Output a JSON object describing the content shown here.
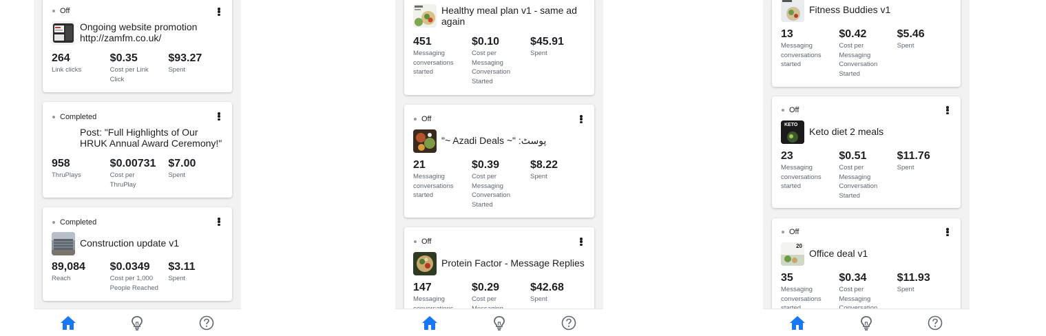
{
  "phones": [
    {
      "cards": [
        {
          "status": "Off",
          "title": "Ongoing website promotion http://zamfm.co.uk/",
          "thumb_icon": "website-thumbnail-icon",
          "metrics": [
            {
              "value": "264",
              "label": "Link clicks"
            },
            {
              "value": "$0.35",
              "label": "Cost per Link Click"
            },
            {
              "value": "$93.27",
              "label": "Spent"
            }
          ]
        },
        {
          "status": "Completed",
          "title": "Post: \"Full Highlights of Our HRUK Annual Award Ceremony!\"",
          "thumb_icon": "",
          "metrics": [
            {
              "value": "958",
              "label": "ThruPlays"
            },
            {
              "value": "$0.00731",
              "label": "Cost per ThruPlay"
            },
            {
              "value": "$7.00",
              "label": "Spent"
            }
          ]
        },
        {
          "status": "Completed",
          "title": "Construction update v1",
          "thumb_icon": "construction-thumbnail-icon",
          "metrics": [
            {
              "value": "89,084",
              "label": "Reach"
            },
            {
              "value": "$0.0349",
              "label": "Cost per 1,000 People Reached"
            },
            {
              "value": "$3.11",
              "label": "Spent"
            }
          ]
        }
      ]
    },
    {
      "cards": [
        {
          "status": "",
          "title": "Healthy meal plan v1 - same ad again",
          "thumb_icon": "meal-plan-thumbnail-icon",
          "metrics": [
            {
              "value": "451",
              "label": "Messaging conversations started"
            },
            {
              "value": "$0.10",
              "label": "Cost per Messaging Conversation Started"
            },
            {
              "value": "$45.91",
              "label": "Spent"
            }
          ]
        },
        {
          "status": "Off",
          "title": "\"~ Azadi Deals ~\" :پوسٹ",
          "thumb_icon": "azadi-deals-thumbnail-icon",
          "metrics": [
            {
              "value": "21",
              "label": "Messaging conversations started"
            },
            {
              "value": "$0.39",
              "label": "Cost per Messaging Conversation Started"
            },
            {
              "value": "$8.22",
              "label": "Spent"
            }
          ]
        },
        {
          "status": "Off",
          "title": "Protein Factor - Message Replies",
          "thumb_icon": "protein-factor-thumbnail-icon",
          "metrics": [
            {
              "value": "147",
              "label": "Messaging conversations started"
            },
            {
              "value": "$0.29",
              "label": "Cost per Messaging Conversation Started"
            },
            {
              "value": "$42.68",
              "label": "Spent"
            }
          ]
        }
      ]
    },
    {
      "cards": [
        {
          "status": "",
          "title": "Fitness Buddies v1",
          "thumb_icon": "fitness-buddies-thumbnail-icon",
          "metrics": [
            {
              "value": "13",
              "label": "Messaging conversations started"
            },
            {
              "value": "$0.42",
              "label": "Cost per Messaging Conversation Started"
            },
            {
              "value": "$5.46",
              "label": "Spent"
            }
          ]
        },
        {
          "status": "Off",
          "title": "Keto diet 2 meals",
          "thumb_icon": "keto-thumbnail-icon",
          "thumb_text": "KETO",
          "metrics": [
            {
              "value": "23",
              "label": "Messaging conversations started"
            },
            {
              "value": "$0.51",
              "label": "Cost per Messaging Conversation Started"
            },
            {
              "value": "$11.76",
              "label": "Spent"
            }
          ]
        },
        {
          "status": "Off",
          "title": "Office deal v1",
          "thumb_icon": "office-deal-thumbnail-icon",
          "thumb_text": "20",
          "metrics": [
            {
              "value": "35",
              "label": "Messaging conversations started"
            },
            {
              "value": "$0.34",
              "label": "Cost per Messaging Conversation Started"
            },
            {
              "value": "$11.93",
              "label": "Spent"
            }
          ]
        }
      ]
    }
  ],
  "navbar": {
    "items": [
      {
        "icon": "home-icon",
        "active": true
      },
      {
        "icon": "lightbulb-icon",
        "active": false
      },
      {
        "icon": "help-icon",
        "active": false
      }
    ],
    "active_color": "#1877f2",
    "inactive_color": "#606770"
  }
}
